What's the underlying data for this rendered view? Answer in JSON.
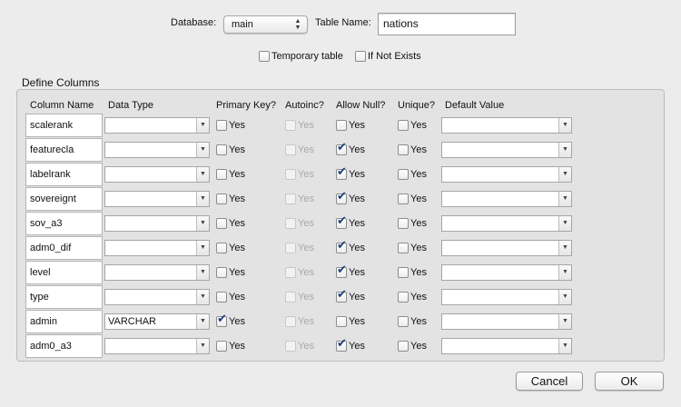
{
  "header": {
    "database_label": "Database:",
    "database_value": "main",
    "table_name_label": "Table Name:",
    "table_name_value": "nations",
    "temporary_label": "Temporary table",
    "if_not_exists_label": "If Not Exists"
  },
  "columns_section": {
    "title": "Define Columns",
    "headers": [
      "Column Name",
      "Data Type",
      "Primary Key?",
      "Autoinc?",
      "Allow Null?",
      "Unique?",
      "Default Value"
    ],
    "checkbox_text": "Yes",
    "rows": [
      {
        "name": "scalerank",
        "type": "",
        "pk": false,
        "autoinc": false,
        "allow_null": false,
        "unique": false,
        "default": ""
      },
      {
        "name": "featurecla",
        "type": "",
        "pk": false,
        "autoinc": false,
        "allow_null": true,
        "unique": false,
        "default": ""
      },
      {
        "name": "labelrank",
        "type": "",
        "pk": false,
        "autoinc": false,
        "allow_null": true,
        "unique": false,
        "default": ""
      },
      {
        "name": "sovereignt",
        "type": "",
        "pk": false,
        "autoinc": false,
        "allow_null": true,
        "unique": false,
        "default": ""
      },
      {
        "name": "sov_a3",
        "type": "",
        "pk": false,
        "autoinc": false,
        "allow_null": true,
        "unique": false,
        "default": ""
      },
      {
        "name": "adm0_dif",
        "type": "",
        "pk": false,
        "autoinc": false,
        "allow_null": true,
        "unique": false,
        "default": ""
      },
      {
        "name": "level",
        "type": "",
        "pk": false,
        "autoinc": false,
        "allow_null": true,
        "unique": false,
        "default": ""
      },
      {
        "name": "type",
        "type": "",
        "pk": false,
        "autoinc": false,
        "allow_null": true,
        "unique": false,
        "default": ""
      },
      {
        "name": "admin",
        "type": "VARCHAR",
        "pk": true,
        "autoinc": false,
        "allow_null": false,
        "unique": false,
        "default": ""
      },
      {
        "name": "adm0_a3",
        "type": "",
        "pk": false,
        "autoinc": false,
        "allow_null": true,
        "unique": false,
        "default": ""
      }
    ]
  },
  "footer": {
    "cancel_label": "Cancel",
    "ok_label": "OK"
  },
  "colors": {
    "window_bg": "#ececec",
    "group_bg": "#e3e3e3",
    "check_color": "#1b3d7a"
  },
  "icons": {
    "popup_arrows": "up-down-arrows-icon",
    "combo_arrow": "chevron-down-icon"
  }
}
